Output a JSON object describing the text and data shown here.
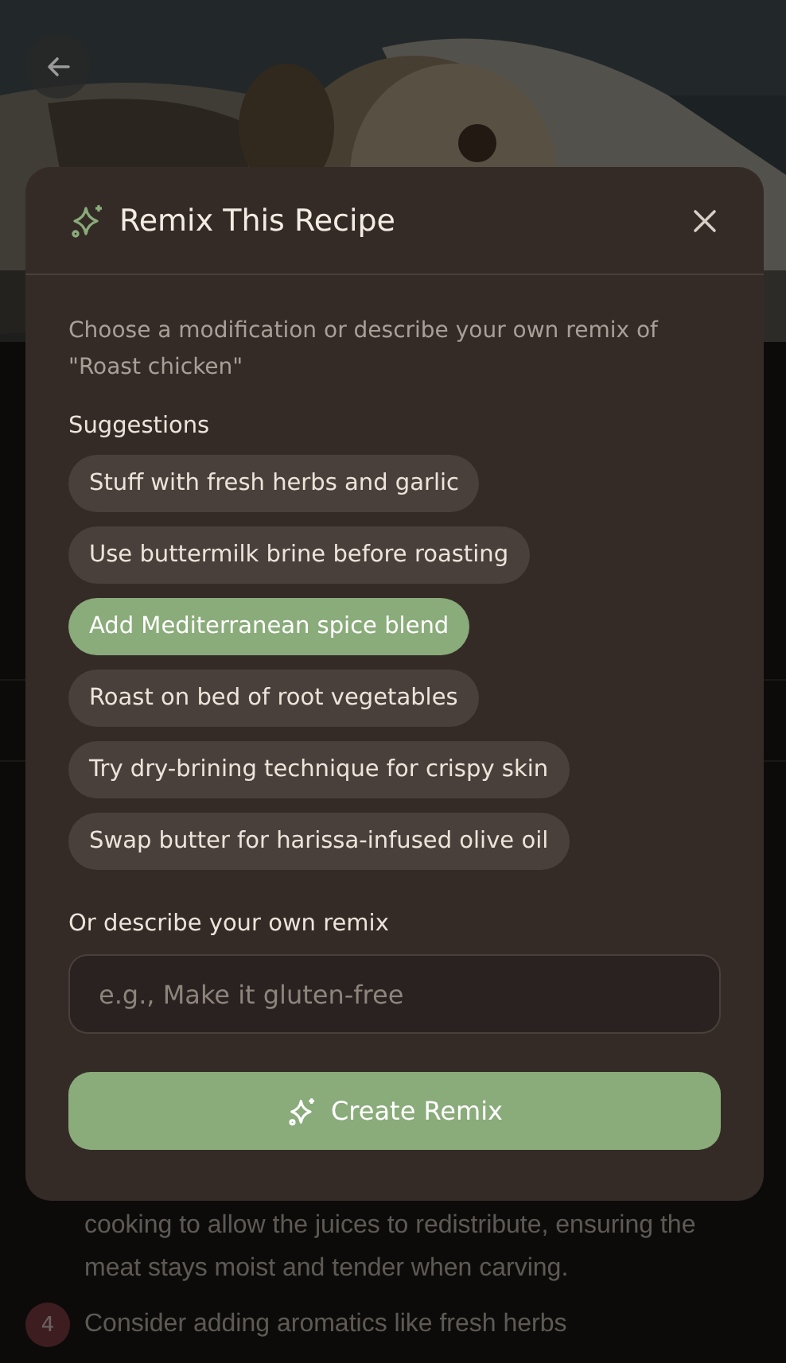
{
  "background": {
    "steps": [
      {
        "text": "cooking to allow the juices to redistribute, ensuring the meat stays moist and tender when carving."
      },
      {
        "number": "4",
        "text": "Consider adding aromatics like fresh herbs"
      }
    ]
  },
  "dialog": {
    "title": "Remix This Recipe",
    "description": "Choose a modification or describe your own remix of \"Roast chicken\"",
    "suggestions_label": "Suggestions",
    "suggestions": [
      {
        "label": "Stuff with fresh herbs and garlic",
        "selected": false
      },
      {
        "label": "Use buttermilk brine before roasting",
        "selected": false
      },
      {
        "label": "Add Mediterranean spice blend",
        "selected": true
      },
      {
        "label": "Roast on bed of root vegetables",
        "selected": false
      },
      {
        "label": "Try dry-brining technique for crispy skin",
        "selected": false
      },
      {
        "label": "Swap butter for harissa-infused olive oil",
        "selected": false
      }
    ],
    "custom_label": "Or describe your own remix",
    "custom_input": {
      "placeholder": "e.g., Make it gluten-free"
    },
    "submit_button": "Create Remix"
  }
}
